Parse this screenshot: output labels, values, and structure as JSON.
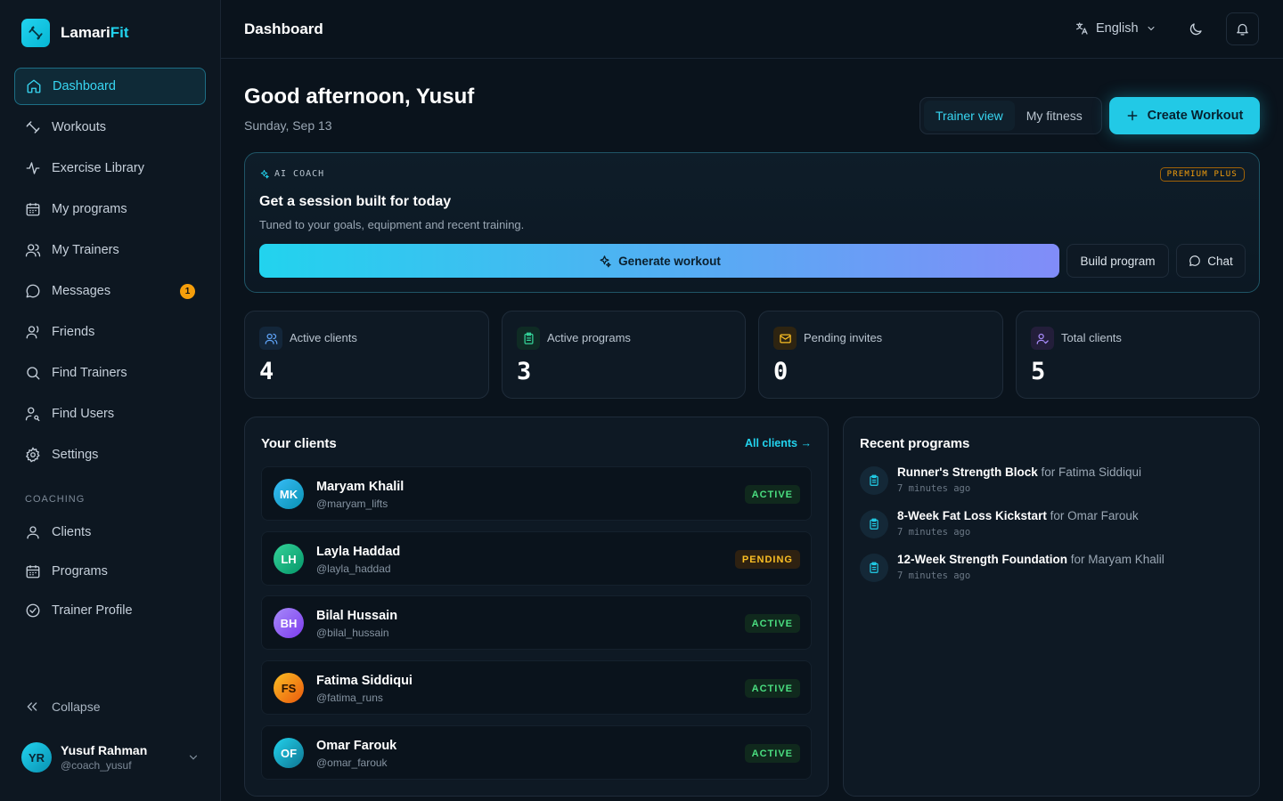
{
  "brand": {
    "name_a": "Lamari",
    "name_b": "Fit"
  },
  "sidebar": {
    "items": [
      {
        "label": "Dashboard",
        "icon": "home-icon",
        "active": true
      },
      {
        "label": "Workouts",
        "icon": "dumbbell-icon"
      },
      {
        "label": "Exercise Library",
        "icon": "activity-icon"
      },
      {
        "label": "My programs",
        "icon": "calendar-icon"
      },
      {
        "label": "My Trainers",
        "icon": "users-icon"
      },
      {
        "label": "Messages",
        "icon": "message-icon",
        "badge": "1"
      },
      {
        "label": "Friends",
        "icon": "friends-icon"
      },
      {
        "label": "Find Trainers",
        "icon": "search-icon"
      },
      {
        "label": "Find Users",
        "icon": "user-search-icon"
      },
      {
        "label": "Settings",
        "icon": "gear-icon"
      }
    ],
    "section_label": "COACHING",
    "coaching_items": [
      {
        "label": "Clients",
        "icon": "user-icon"
      },
      {
        "label": "Programs",
        "icon": "calendar-icon"
      },
      {
        "label": "Trainer Profile",
        "icon": "badge-check-icon"
      }
    ],
    "collapse_label": "Collapse",
    "user": {
      "initials": "YR",
      "name": "Yusuf Rahman",
      "handle": "@coach_yusuf"
    }
  },
  "header": {
    "title": "Dashboard",
    "language": "English"
  },
  "main": {
    "greeting": "Good afternoon, Yusuf",
    "date": "Sunday, Sep 13",
    "view_toggle": {
      "trainer": "Trainer view",
      "fitness": "My fitness"
    },
    "create_label": "Create Workout"
  },
  "ai_coach": {
    "tag": "AI COACH",
    "badge": "PREMIUM PLUS",
    "title": "Get a session built for today",
    "subtitle": "Tuned to your goals, equipment and recent training.",
    "generate_label": "Generate workout",
    "build_label": "Build program",
    "chat_label": "Chat"
  },
  "stats": [
    {
      "label": "Active clients",
      "value": "4",
      "color": "#60a5fa"
    },
    {
      "label": "Active programs",
      "value": "3",
      "color": "#34d399"
    },
    {
      "label": "Pending invites",
      "value": "0",
      "color": "#fbbf24"
    },
    {
      "label": "Total clients",
      "value": "5",
      "color": "#a78bfa"
    }
  ],
  "clients": {
    "title": "Your clients",
    "link": "All clients →",
    "rows": [
      {
        "initials": "MK",
        "name": "Maryam Khalil",
        "handle": "@maryam_lifts",
        "status": "ACTIVE",
        "color": "#22b8d6"
      },
      {
        "initials": "LH",
        "name": "Layla Haddad",
        "handle": "@layla_haddad",
        "status": "PENDING",
        "color": "#10b981"
      },
      {
        "initials": "BH",
        "name": "Bilal Hussain",
        "handle": "@bilal_hussain",
        "status": "ACTIVE",
        "color": "#8b5cf6"
      },
      {
        "initials": "FS",
        "name": "Fatima Siddiqui",
        "handle": "@fatima_runs",
        "status": "ACTIVE",
        "color": "#f59e0b"
      },
      {
        "initials": "OF",
        "name": "Omar Farouk",
        "handle": "@omar_farouk",
        "status": "ACTIVE",
        "color": "#06b6d4"
      }
    ]
  },
  "programs": {
    "title": "Recent programs",
    "items": [
      {
        "name": "Runner's Strength Block",
        "for_text": "for Fatima Siddiqui",
        "time": "7 minutes ago"
      },
      {
        "name": "8-Week Fat Loss Kickstart",
        "for_text": "for Omar Farouk",
        "time": "7 minutes ago"
      },
      {
        "name": "12-Week Strength Foundation",
        "for_text": "for Maryam Khalil",
        "time": "7 minutes ago"
      }
    ]
  }
}
